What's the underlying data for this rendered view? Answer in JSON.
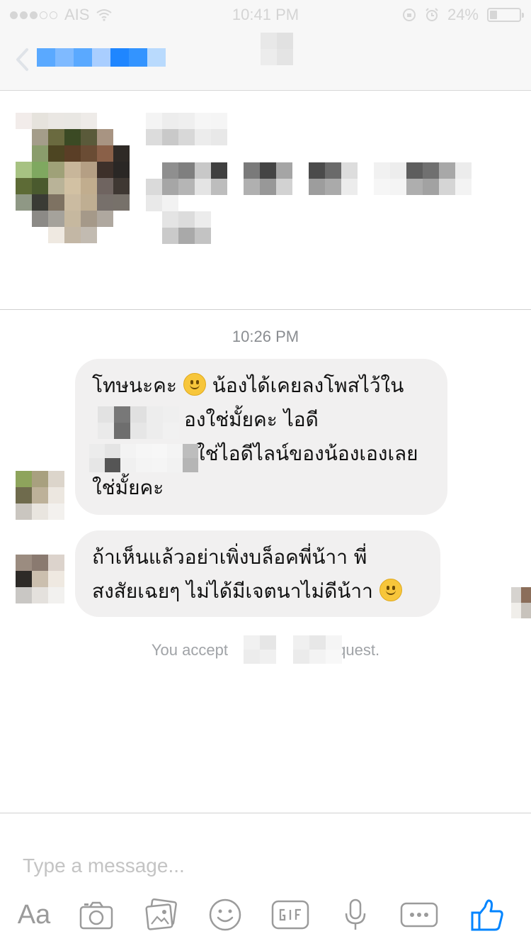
{
  "status_bar": {
    "carrier": "AIS",
    "time": "10:41 PM",
    "battery_percent": "24%",
    "battery_level": 0.24
  },
  "conversation": {
    "timestamp": "10:26 PM",
    "messages": [
      {
        "lines": [
          {
            "before": "โทษนะคะ ",
            "emoji": "slightly-smiling-face",
            "after": " น้องได้เคยลงโพสไว้ใน"
          },
          {
            "text": "องใช่มั้ยคะ ไอดี"
          },
          {
            "text": "ใช่ไอดีไลน์ของน้องเองเลย"
          },
          {
            "text": "ใช่มั้ยคะ"
          }
        ]
      },
      {
        "lines": [
          {
            "text": "ถ้าเห็นแล้วอย่าเพิ่งบล็อคพี่น้าา พี่"
          },
          {
            "before": "สงสัยเฉยๆ ไม่ได้มีเจตนาไม่ดีน้าา ",
            "emoji": "smiling-face-with-smiling-eyes"
          }
        ]
      }
    ],
    "system_note": {
      "part1": "You accept",
      "part2": "equest."
    }
  },
  "composer": {
    "placeholder": "Type a message...",
    "aa_label": "Aa",
    "icons": [
      "camera-icon",
      "photo-gallery-icon",
      "emoji-icon",
      "gif-icon",
      "microphone-icon",
      "more-icon",
      "like-thumb-icon"
    ],
    "accent_color": "#0084ff"
  }
}
